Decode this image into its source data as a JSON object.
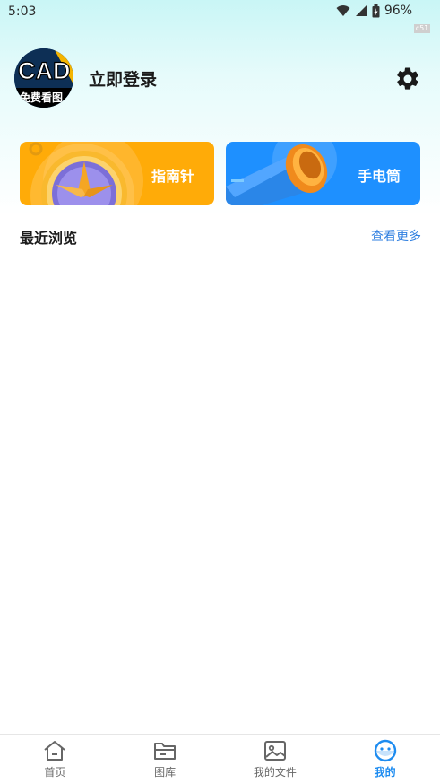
{
  "status_bar": {
    "time": "5:03",
    "battery": "96%",
    "build_badge": "c51"
  },
  "profile": {
    "avatar_text_top": "CAD",
    "avatar_text_bottom": "免费看图",
    "login_label": "立即登录"
  },
  "cards": [
    {
      "label": "指南针",
      "color": "#ffab08",
      "icon": "compass-icon"
    },
    {
      "label": "手电筒",
      "color": "#1e90ff",
      "icon": "flashlight-icon"
    }
  ],
  "recent": {
    "title": "最近浏览",
    "more_label": "查看更多"
  },
  "bottom_nav": {
    "items": [
      {
        "label": "首页",
        "icon": "home-icon",
        "active": false
      },
      {
        "label": "图库",
        "icon": "folder-icon",
        "active": false
      },
      {
        "label": "我的文件",
        "icon": "image-icon",
        "active": false
      },
      {
        "label": "我的",
        "icon": "smiley-icon",
        "active": true
      }
    ],
    "active_color": "#1e8cf0"
  }
}
